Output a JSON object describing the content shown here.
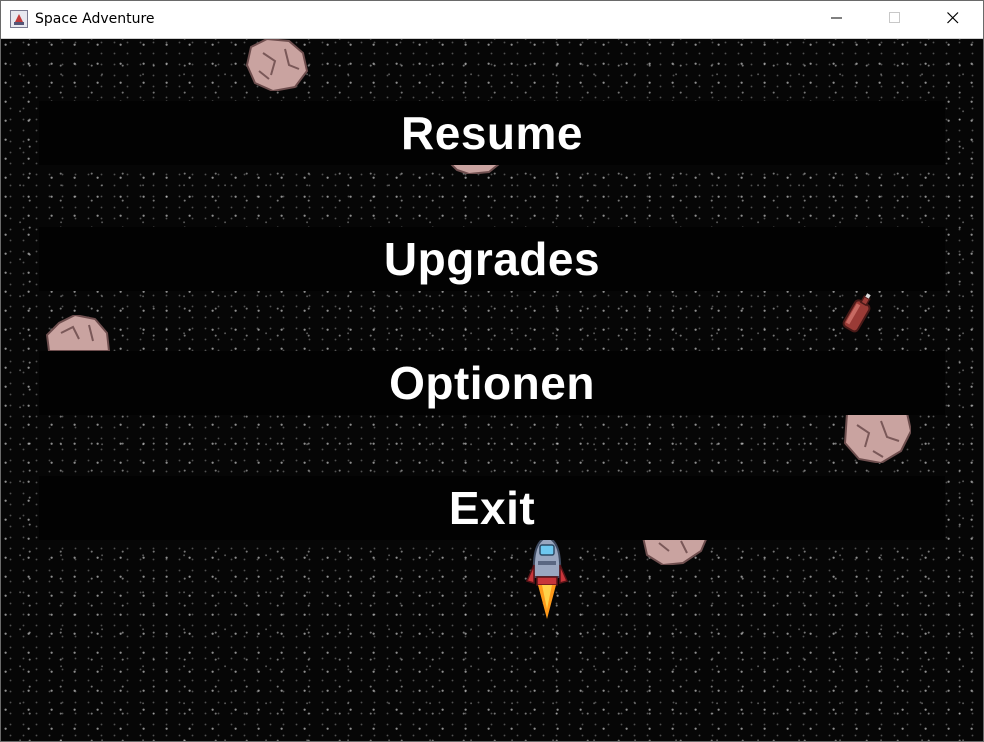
{
  "window": {
    "title": "Space Adventure",
    "app_icon": "java-cup-icon",
    "controls": [
      "minimize-icon",
      "maximize-icon",
      "close-icon"
    ]
  },
  "menu": {
    "items": [
      {
        "label": "Resume"
      },
      {
        "label": "Upgrades"
      },
      {
        "label": "Optionen"
      },
      {
        "label": "Exit"
      }
    ],
    "text_color": "#ffffff",
    "bar_color": "#020202"
  },
  "scene": {
    "background_color": "#060606",
    "sprites": [
      "asteroid",
      "asteroid",
      "asteroid",
      "asteroid",
      "asteroid",
      "fuel-canister",
      "player-rocket"
    ],
    "asteroid_color": "#c49a98",
    "rocket_flame_color": "#ff9a1a"
  }
}
